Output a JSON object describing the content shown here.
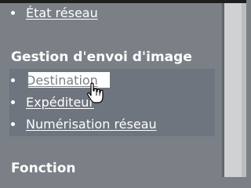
{
  "nav": {
    "top_item": "État réseau",
    "section_title": "Gestion d'envoi d'image",
    "items": [
      {
        "label": "Destination",
        "highlighted": true
      },
      {
        "label": "Expéditeur"
      },
      {
        "label": "Numérisation réseau"
      }
    ],
    "bottom_title": "Fonction"
  },
  "colors": {
    "sidebar_bg": "#7b8086",
    "submenu_bg": "#6e757f",
    "text": "#ffffff",
    "scrollbar": "#d0d1d3"
  },
  "icons": {
    "cursor": "hand-pointer-icon"
  }
}
